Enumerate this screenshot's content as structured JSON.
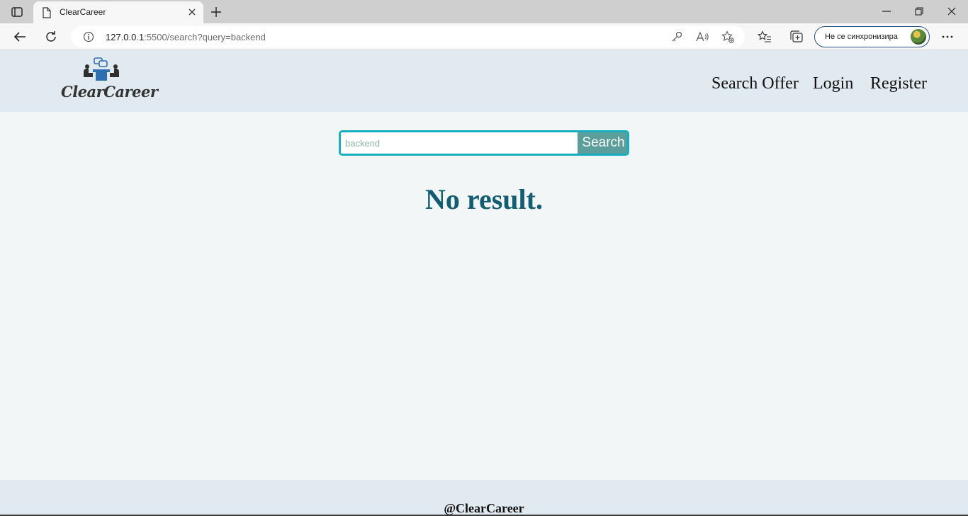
{
  "browser": {
    "tab_title": "ClearCareer",
    "url_host": "127.0.0.1",
    "url_rest": ":5500/search?query=backend",
    "profile_label": "Не се синхронизира"
  },
  "header": {
    "logo_text": "ClearCareer",
    "nav": {
      "search_offer": "Search Offer",
      "login": "Login",
      "register": "Register"
    }
  },
  "search": {
    "placeholder": "backend",
    "button_label": "Search"
  },
  "main": {
    "message": "No result."
  },
  "footer": {
    "text": "@ClearCareer"
  },
  "colors": {
    "header_bg": "#e1eaf0",
    "page_bg": "#f2f6f7",
    "accent_border": "#17aebf",
    "search_button": "#5b9e9b",
    "message_text": "#125d72",
    "logo_blue": "#2e6fb0"
  }
}
